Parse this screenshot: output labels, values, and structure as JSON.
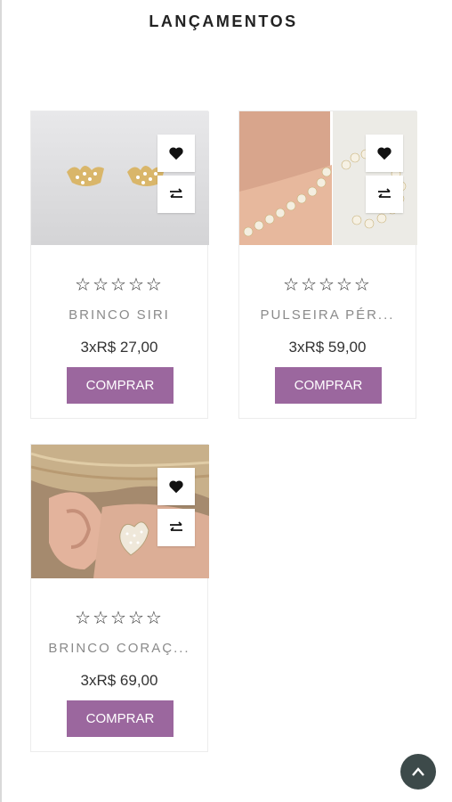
{
  "section": {
    "title": "LANÇAMENTOS"
  },
  "products": [
    {
      "name": "BRINCO SIRI",
      "price": "3xR$ 27,00",
      "rating_stars": "☆☆☆☆☆",
      "buy_label": "COMPRAR"
    },
    {
      "name": "PULSEIRA PÉR...",
      "price": "3xR$ 59,00",
      "rating_stars": "☆☆☆☆☆",
      "buy_label": "COMPRAR"
    },
    {
      "name": "BRINCO CORAÇ...",
      "price": "3xR$ 69,00",
      "rating_stars": "☆☆☆☆☆",
      "buy_label": "COMPRAR"
    }
  ],
  "icons": {
    "wishlist": "heart-icon",
    "compare": "compare-arrows-icon",
    "scroll_top": "chevron-up-icon"
  },
  "colors": {
    "accent": "#9b679e",
    "scroll_top_bg": "#3d4a4a"
  }
}
